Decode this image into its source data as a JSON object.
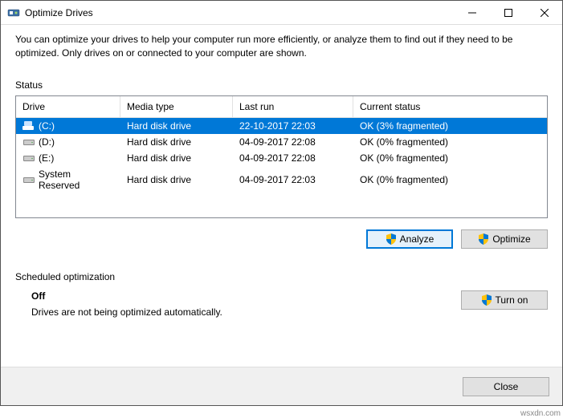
{
  "window": {
    "title": "Optimize Drives"
  },
  "description": "You can optimize your drives to help your computer run more efficiently, or analyze them to find out if they need to be optimized. Only drives on or connected to your computer are shown.",
  "status_label": "Status",
  "columns": {
    "drive": "Drive",
    "media": "Media type",
    "last": "Last run",
    "status": "Current status"
  },
  "drives": [
    {
      "name": "(C:)",
      "media": "Hard disk drive",
      "last": "22-10-2017 22:03",
      "status": "OK (3% fragmented)",
      "selected": true,
      "icon": "system"
    },
    {
      "name": "(D:)",
      "media": "Hard disk drive",
      "last": "04-09-2017 22:08",
      "status": "OK (0% fragmented)",
      "selected": false,
      "icon": "hdd"
    },
    {
      "name": "(E:)",
      "media": "Hard disk drive",
      "last": "04-09-2017 22:08",
      "status": "OK (0% fragmented)",
      "selected": false,
      "icon": "hdd"
    },
    {
      "name": "System Reserved",
      "media": "Hard disk drive",
      "last": "04-09-2017 22:03",
      "status": "OK (0% fragmented)",
      "selected": false,
      "icon": "hdd"
    }
  ],
  "buttons": {
    "analyze": "Analyze",
    "optimize": "Optimize",
    "turn_on": "Turn on",
    "close": "Close"
  },
  "scheduled": {
    "label": "Scheduled optimization",
    "state": "Off",
    "desc": "Drives are not being optimized automatically."
  },
  "watermark": "wsxdn.com"
}
